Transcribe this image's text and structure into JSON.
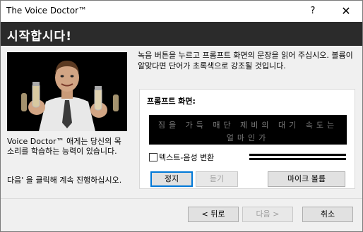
{
  "window": {
    "title": "The Voice Doctor™",
    "help_label": "?",
    "close_label": "✕"
  },
  "banner": {
    "title": "시작합시다!"
  },
  "left": {
    "description": "Voice Doctor™ 애게는 당신의 목소리를 학습하는 능력이 있습니다.",
    "hint": "다음' 을 클릭해 계속 진행하십시오."
  },
  "instructions": "녹음 버튼을 누르고 프롬프트 화면의 문장을 읽어 주십시오. 볼륨이 알맞다면 단어가 초록색으로 강조될 것입니다.",
  "prompt": {
    "label": "프롬프트 화면:",
    "line1": "짐을 가득 매단 제비의 대기 속도는",
    "line2": "얼마인가",
    "tts_label": "텍스트-음성 변환",
    "tts_checked": false
  },
  "buttons": {
    "stop": "정지",
    "listen": "듣기",
    "mic_volume": "마이크 볼륨",
    "back": "< 뒤로",
    "next": "다음 >",
    "cancel": "취소"
  },
  "colors": {
    "banner_bg": "#2b2b2b",
    "prompt_bg": "#000000",
    "prompt_text": "#7a7a7a",
    "focus_border": "#0078d7"
  }
}
